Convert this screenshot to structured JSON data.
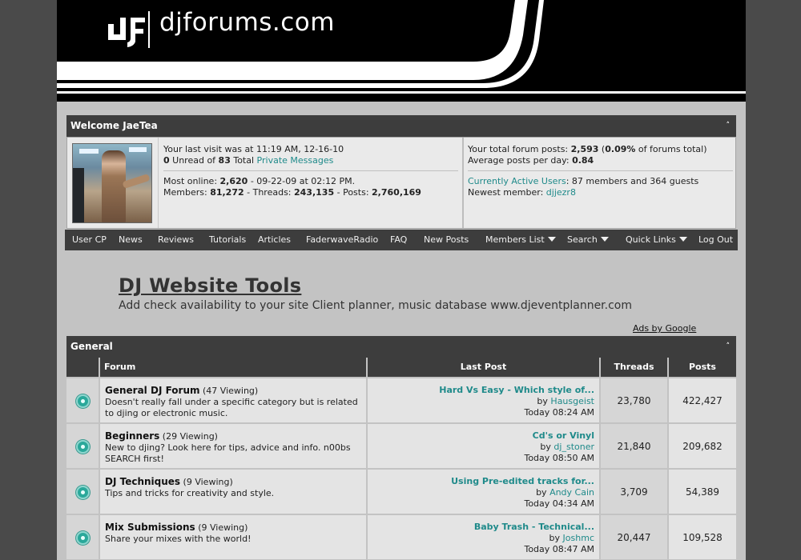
{
  "site": {
    "logo_mark": "dF",
    "logo_text": "djforums.com"
  },
  "welcome": {
    "title": "Welcome JaeTea",
    "collapse": "˄",
    "last_visit_prefix": "Your last visit was at ",
    "last_visit_value": "11:19 AM, 12-16-10",
    "unread_count": "0",
    "unread_mid": " Unread of ",
    "total_count": "83",
    "total_label": " Total ",
    "pm_link": "Private Messages",
    "most_online_label": "Most online: ",
    "most_online_count": "2,620",
    "most_online_date": " - 09-22-09 at 02:12 PM.",
    "members_label": "Members: ",
    "members_count": "81,272",
    "threads_label": " - Threads: ",
    "threads_count": "243,135",
    "posts_label": " - Posts: ",
    "posts_count": "2,760,169",
    "your_posts_label": "Your total forum posts: ",
    "your_posts_count": "2,593",
    "your_posts_pct_open": " (",
    "your_posts_pct": "0.09%",
    "your_posts_pct_close": " of forums total)",
    "avg_label": "Average posts per day: ",
    "avg_value": "0.84",
    "active_users_link": "Currently Active Users",
    "active_users_text": ": 87 members and 364 guests",
    "newest_label": "Newest member: ",
    "newest_member": "djjezr8"
  },
  "navbar": {
    "items": [
      {
        "label": "User CP"
      },
      {
        "label": "News"
      },
      {
        "label": "Reviews"
      },
      {
        "label": "Tutorials"
      },
      {
        "label": "Articles"
      },
      {
        "label": "FaderwaveRadio"
      },
      {
        "label": "FAQ"
      },
      {
        "label": "New Posts"
      },
      {
        "label": "Members List"
      },
      {
        "label": "Search"
      },
      {
        "label": "Quick Links"
      },
      {
        "label": "Log Out"
      }
    ]
  },
  "ad": {
    "title": "DJ Website Tools",
    "body": "Add check availability to your site Client planner, music database ",
    "url": "www.djeventplanner.com",
    "ads_by": "Ads by Google"
  },
  "general": {
    "title": "General",
    "collapse": "˄",
    "columns": {
      "forum": "Forum",
      "last_post": "Last Post",
      "threads": "Threads",
      "posts": "Posts"
    },
    "forums": [
      {
        "name": "General DJ Forum",
        "viewing": " (47 Viewing)",
        "description": "Doesn't really fall under a specific category but is related to djing or electronic music.",
        "last_title": "Hard Vs Easy - Which style of...",
        "by": "by ",
        "last_user": "Hausgeist",
        "last_time": "Today 08:24 AM",
        "threads": "23,780",
        "posts": "422,427"
      },
      {
        "name": "Beginners",
        "viewing": " (29 Viewing)",
        "description": "New to djing? Look here for tips, advice and info. n00bs SEARCH first!",
        "last_title": "Cd's or Vinyl",
        "by": "by ",
        "last_user": "dj_stoner",
        "last_time": "Today 08:50 AM",
        "threads": "21,840",
        "posts": "209,682"
      },
      {
        "name": "DJ Techniques",
        "viewing": " (9 Viewing)",
        "description": "Tips and tricks for creativity and style.",
        "last_title": "Using Pre-edited tracks for...",
        "by": "by ",
        "last_user": "Andy Cain",
        "last_time": "Today 04:34 AM",
        "threads": "3,709",
        "posts": "54,389"
      },
      {
        "name": "Mix Submissions",
        "viewing": " (9 Viewing)",
        "description": "Share your mixes with the world!",
        "last_title": "Baby Trash - Technical...",
        "by": "by ",
        "last_user": "Joshmc",
        "last_time": "Today 08:47 AM",
        "threads": "20,447",
        "posts": "109,528"
      }
    ]
  }
}
